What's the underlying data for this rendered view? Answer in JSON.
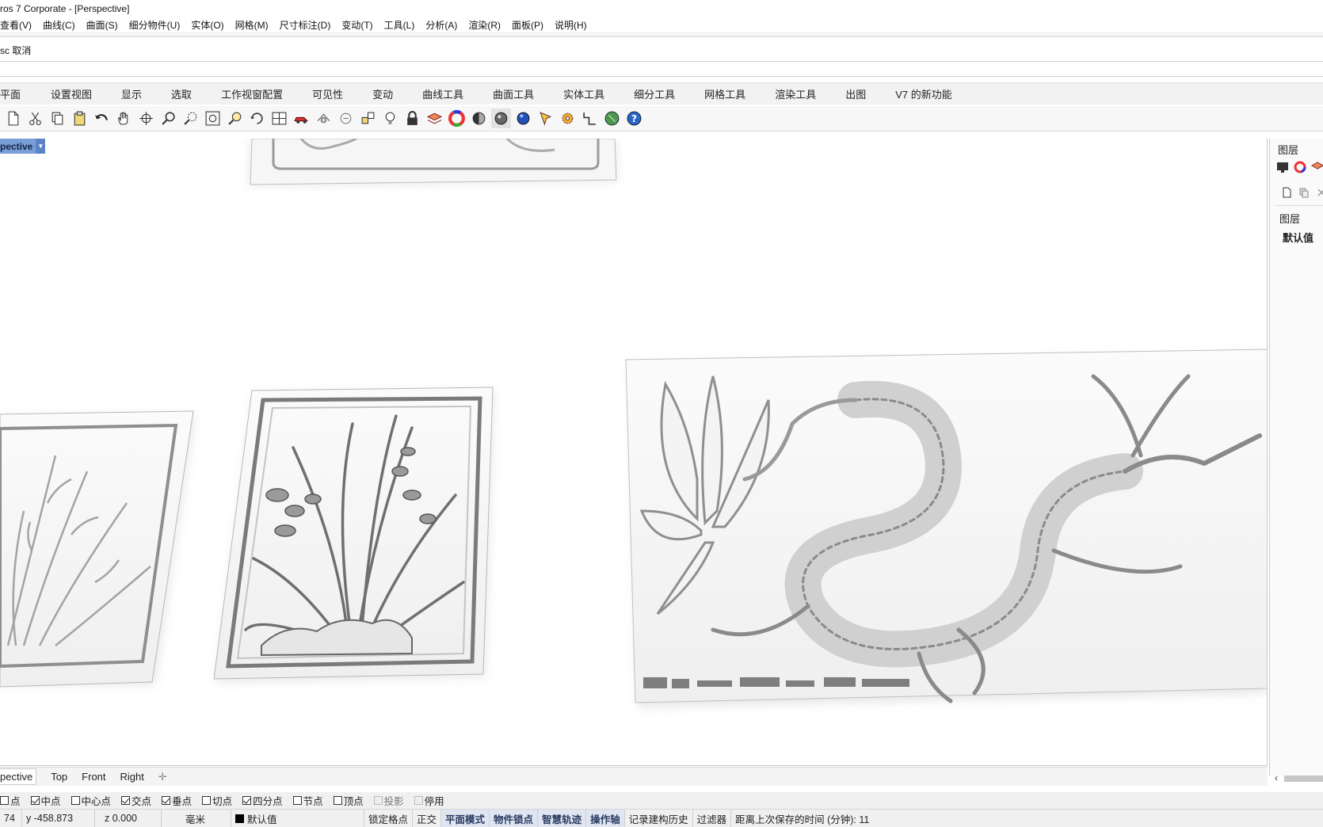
{
  "window": {
    "title": "ros 7 Corporate - [Perspective]"
  },
  "menu": [
    "查看(V)",
    "曲线(C)",
    "曲面(S)",
    "细分物件(U)",
    "实体(O)",
    "网格(M)",
    "尺寸标注(D)",
    "变动(T)",
    "工具(L)",
    "分析(A)",
    "渲染(R)",
    "面板(P)",
    "说明(H)"
  ],
  "command": {
    "history": "sc 取消",
    "prompt": ""
  },
  "toolbar_tabs": [
    "平面",
    "设置视图",
    "显示",
    "选取",
    "工作视窗配置",
    "可见性",
    "变动",
    "曲线工具",
    "曲面工具",
    "实体工具",
    "细分工具",
    "网格工具",
    "渲染工具",
    "出图",
    "V7 的新功能"
  ],
  "toolbar_icons": [
    "new-file-icon",
    "cut-icon",
    "copy-icon",
    "paste-icon",
    "undo-icon",
    "pan-hand-icon",
    "rotate-view-icon",
    "zoom-icon",
    "zoom-window-icon",
    "zoom-extents-icon",
    "zoom-selected-icon",
    "rotate-camera-icon",
    "four-viewports-icon",
    "car-icon",
    "object-properties-icon",
    "hide-icon",
    "show-objects-icon",
    "light-bulb-icon",
    "lock-icon",
    "layer-icon",
    "color-wheel-icon",
    "shaded-sphere-icon",
    "rendered-sphere-icon",
    "blue-sphere-icon",
    "options-icon",
    "gear-icon",
    "curve-tools-icon",
    "globe-icon",
    "help-icon"
  ],
  "viewport": {
    "label": "pective"
  },
  "right_panel": {
    "title": "图层",
    "header": "图层",
    "layer_row": "默认值"
  },
  "viewport_tabs": [
    "pective",
    "Top",
    "Front",
    "Right"
  ],
  "osnaps": [
    {
      "label": "点",
      "checked": false
    },
    {
      "label": "中点",
      "checked": true
    },
    {
      "label": "中心点",
      "checked": false
    },
    {
      "label": "交点",
      "checked": true
    },
    {
      "label": "垂点",
      "checked": true
    },
    {
      "label": "切点",
      "checked": false
    },
    {
      "label": "四分点",
      "checked": true
    },
    {
      "label": "节点",
      "checked": false
    },
    {
      "label": "顶点",
      "checked": false
    },
    {
      "label": "投影",
      "checked": false
    },
    {
      "label": "停用",
      "checked": false
    }
  ],
  "status": {
    "x": "74",
    "y": "y -458.873",
    "z": "z 0.000",
    "units": "毫米",
    "layer": "默认值",
    "grid_snap": "锁定格点",
    "ortho": "正交",
    "planar": "平面模式",
    "osnap": "物件锁点",
    "smarttrack": "智慧轨迹",
    "gumball": "操作轴",
    "history": "记录建构历史",
    "filter": "过滤器",
    "autosave": "距离上次保存的时间 (分钟): 11"
  },
  "colors": {
    "viewport_label_bg": "#7a9ed6",
    "status_highlight_bg": "#dfe6f2"
  }
}
